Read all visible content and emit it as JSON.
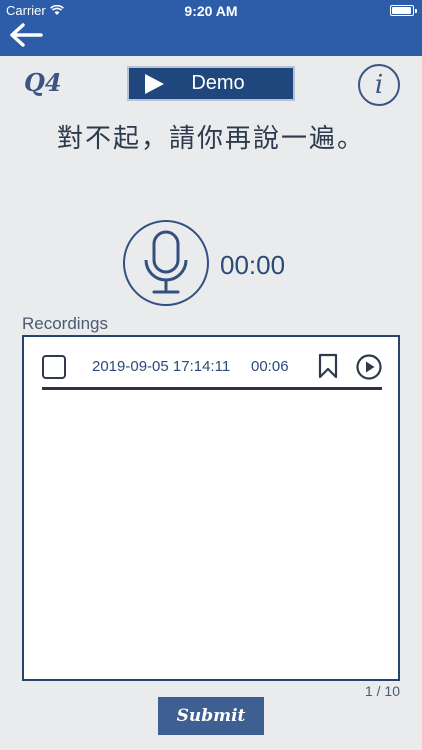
{
  "status_bar": {
    "carrier": "Carrier",
    "time": "9:20 AM"
  },
  "header": {
    "back_icon": "arrow-left-icon",
    "color": "#2d5ca8"
  },
  "question": {
    "label": "Q4",
    "prompt": "對不起，請你再說一遍。"
  },
  "demo_button": {
    "label": "Demo",
    "icon": "play-icon"
  },
  "info_button": {
    "label": "i"
  },
  "recorder": {
    "timer": "00:00",
    "icon": "microphone-icon"
  },
  "recordings": {
    "title": "Recordings",
    "items": [
      {
        "date": "2019-09-05 17:14:11",
        "duration": "00:06",
        "checked": false
      }
    ],
    "page": "1 / 10"
  },
  "submit": {
    "label": "Submit"
  },
  "colors": {
    "accent": "#1f477d",
    "panel_border": "#27446f",
    "background": "#eaebec"
  }
}
